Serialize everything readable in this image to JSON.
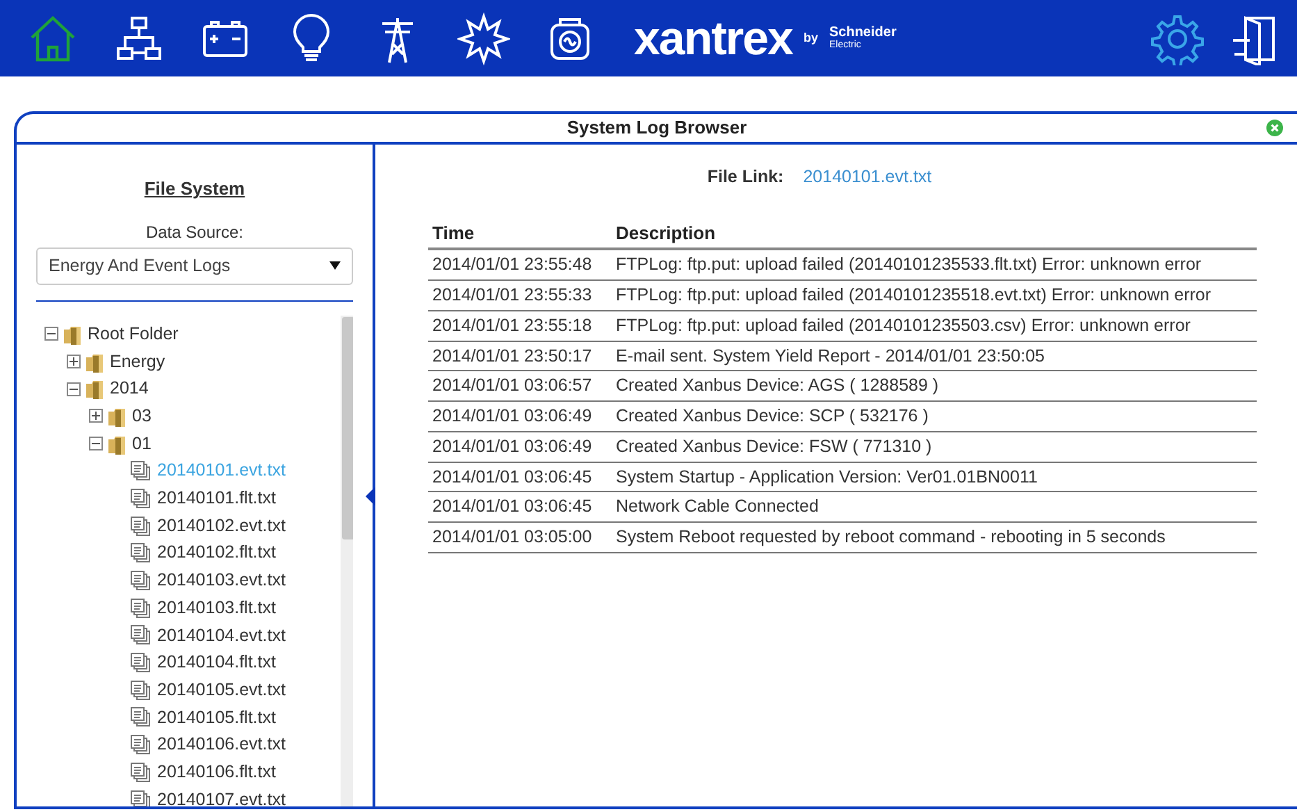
{
  "toolbar": {
    "items": [
      {
        "kind": "home",
        "selected": true
      },
      {
        "kind": "network",
        "selected": false
      },
      {
        "kind": "battery",
        "selected": false
      },
      {
        "kind": "bulb",
        "selected": false
      },
      {
        "kind": "tower",
        "selected": false
      },
      {
        "kind": "sun",
        "selected": false
      },
      {
        "kind": "generator",
        "selected": false
      }
    ],
    "logo": {
      "brand": "xantrex",
      "by": "by",
      "maker_line_1": "Schneider",
      "maker_line_2": "Electric"
    },
    "right_items": [
      {
        "kind": "settings",
        "selected": false
      },
      {
        "kind": "exit",
        "selected": false
      }
    ]
  },
  "window": {
    "title": "System Log Browser"
  },
  "sidebar": {
    "heading": "File System",
    "source_label": "Data Source:",
    "source_value": "Energy And Event Logs",
    "tree": [
      {
        "label": "Root Folder",
        "kind": "folder",
        "expanded": true,
        "selected": false,
        "children": [
          {
            "label": "Energy",
            "kind": "folder",
            "expanded": false,
            "selected": false
          },
          {
            "label": "2014",
            "kind": "folder",
            "expanded": true,
            "selected": false,
            "children": [
              {
                "label": "03",
                "kind": "folder",
                "expanded": false,
                "selected": false
              },
              {
                "label": "01",
                "kind": "folder",
                "expanded": true,
                "selected": false,
                "children": [
                  {
                    "label": "20140101.evt.txt",
                    "kind": "file",
                    "selected": true
                  },
                  {
                    "label": "20140101.flt.txt",
                    "kind": "file",
                    "selected": false
                  },
                  {
                    "label": "20140102.evt.txt",
                    "kind": "file",
                    "selected": false
                  },
                  {
                    "label": "20140102.flt.txt",
                    "kind": "file",
                    "selected": false
                  },
                  {
                    "label": "20140103.evt.txt",
                    "kind": "file",
                    "selected": false
                  },
                  {
                    "label": "20140103.flt.txt",
                    "kind": "file",
                    "selected": false
                  },
                  {
                    "label": "20140104.evt.txt",
                    "kind": "file",
                    "selected": false
                  },
                  {
                    "label": "20140104.flt.txt",
                    "kind": "file",
                    "selected": false
                  },
                  {
                    "label": "20140105.evt.txt",
                    "kind": "file",
                    "selected": false
                  },
                  {
                    "label": "20140105.flt.txt",
                    "kind": "file",
                    "selected": false
                  },
                  {
                    "label": "20140106.evt.txt",
                    "kind": "file",
                    "selected": false
                  },
                  {
                    "label": "20140106.flt.txt",
                    "kind": "file",
                    "selected": false
                  },
                  {
                    "label": "20140107.evt.txt",
                    "kind": "file",
                    "selected": false
                  }
                ]
              }
            ]
          }
        ]
      }
    ]
  },
  "file_link": {
    "label": "File Link:",
    "value": "20140101.evt.txt"
  },
  "table": {
    "columns": [
      "Time",
      "Description"
    ],
    "rows": [
      [
        "2014/01/01 23:55:48",
        "FTPLog: ftp.put: upload failed (20140101235533.flt.txt) Error: unknown error"
      ],
      [
        "2014/01/01 23:55:33",
        "FTPLog: ftp.put: upload failed (20140101235518.evt.txt) Error: unknown error"
      ],
      [
        "2014/01/01 23:55:18",
        "FTPLog: ftp.put: upload failed (20140101235503.csv) Error: unknown error"
      ],
      [
        "2014/01/01 23:50:17",
        "E-mail sent. System Yield Report - 2014/01/01 23:50:05"
      ],
      [
        "2014/01/01 03:06:57",
        "Created Xanbus Device: AGS ( 1288589 )"
      ],
      [
        "2014/01/01 03:06:49",
        "Created Xanbus Device: SCP ( 532176 )"
      ],
      [
        "2014/01/01 03:06:49",
        "Created Xanbus Device: FSW ( 771310 )"
      ],
      [
        "2014/01/01 03:06:45",
        "System Startup - Application Version: Ver01.01BN0011"
      ],
      [
        "2014/01/01 03:06:45",
        "Network Cable Connected"
      ],
      [
        "2014/01/01 03:05:00",
        "System Reboot requested by reboot command - rebooting in 5 seconds"
      ]
    ]
  }
}
